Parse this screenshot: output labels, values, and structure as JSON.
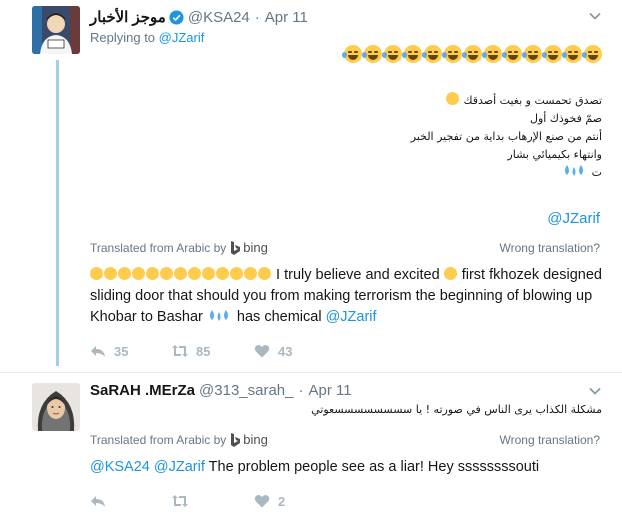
{
  "tweet1": {
    "display_name": "موجز الأخبار",
    "handle": "@KSA24",
    "separator": "·",
    "time": "Apr 11",
    "replying_prefix": "Replying to",
    "replying_to": "@JZarif",
    "arabic_lines": [
      "تصدق تحمست و بغيت أصدقك",
      "صمّ فخوذك أول",
      "أنتم من صنع الإرهاب بداية من تفجير الخبر",
      "وانتهاء بكيميائي بشار",
      "ت"
    ],
    "mention": "@JZarif",
    "translated_label": "Translated from Arabic by",
    "bing_label": "bing",
    "wrong_translation": "Wrong translation?",
    "translation_text_1": "I truly believe and excited",
    "translation_text_2": "first fkhozek designed sliding door that should you from making terrorism the beginning of blowing up Khobar to Bashar",
    "translation_text_3": "has chemical",
    "translation_mention": "@JZarif",
    "reply_count": "35",
    "retweet_count": "85",
    "like_count": "43"
  },
  "tweet2": {
    "display_name": "SaRAH .MErZa",
    "handle": "@313_sarah_",
    "separator": "·",
    "time": "Apr 11",
    "arabic_text": "مشكلة الكذاب يرى الناس في صورته ! يا سسسسسسسسعوتي",
    "translated_label": "Translated from Arabic by",
    "bing_label": "bing",
    "wrong_translation": "Wrong translation?",
    "translation_mention_1": "@KSA24",
    "translation_mention_2": "@JZarif",
    "translation_text": "The problem people see as a liar! Hey ssssssssouti",
    "reply_count": "",
    "retweet_count": "",
    "like_count": "2"
  },
  "colors": {
    "link": "#1b95e0",
    "muted": "#657786",
    "icon": "#aab8c2",
    "thread_line": "#9fd0e8"
  }
}
